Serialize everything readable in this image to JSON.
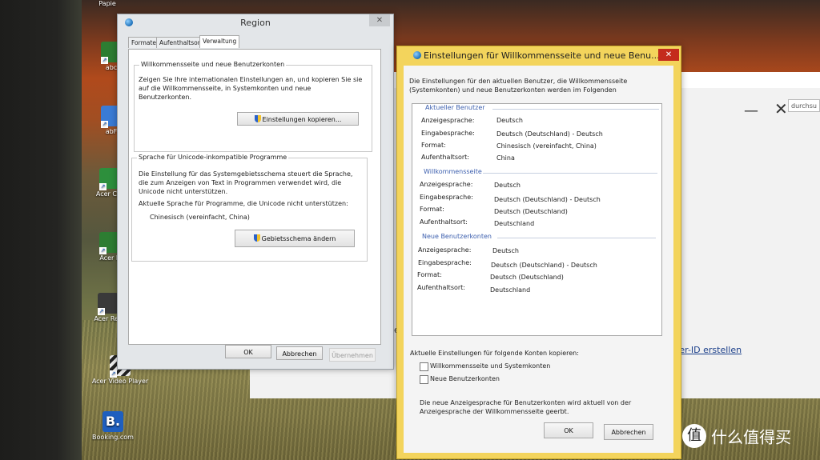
{
  "desktop": {
    "icons": [
      {
        "label": "Papie",
        "icon": "folder-icon",
        "color": "#d9b44a"
      },
      {
        "label": "abc",
        "icon": "app-icon",
        "color": "#2d7d32"
      },
      {
        "label": "abF",
        "icon": "app-icon",
        "color": "#3a7bd5"
      },
      {
        "label": "Acer Car",
        "icon": "app-icon",
        "color": "#2d8f3c"
      },
      {
        "label": "Acer P",
        "icon": "app-icon",
        "color": "#2d7d32"
      },
      {
        "label": "Acer Rev",
        "icon": "app-icon",
        "color": "#3a3a3a"
      },
      {
        "label": "Acer Video Player",
        "icon": "clapperboard-icon",
        "color": "#e0e0e0"
      },
      {
        "label": "Booking.com",
        "icon": "booking-icon",
        "color": "#1e5fbf"
      }
    ]
  },
  "back_window": {
    "search_placeholder": "durchsu",
    "minimize": "—",
    "close": "✕",
    "link": "Acer-ID erstellen",
    "fragment": "wie"
  },
  "region": {
    "title": "Region",
    "close": "✕",
    "tabs": [
      "Formate",
      "Aufenthaltsort",
      "Verwaltung"
    ],
    "active_tab": "Verwaltung",
    "group1": {
      "legend": "Willkommensseite und neue Benutzerkonten",
      "text": "Zeigen Sie Ihre internationalen Einstellungen an, und kopieren Sie sie auf die Willkommensseite, in Systemkonten und neue Benutzerkonten.",
      "button": "Einstellungen kopieren..."
    },
    "group2": {
      "legend": "Sprache für Unicode-inkompatible Programme",
      "text": "Die Einstellung für das Systemgebietsschema steuert die Sprache, die zum Anzeigen von Text in Programmen verwendet wird, die Unicode nicht unterstützen.",
      "current_label": "Aktuelle Sprache für Programme, die Unicode nicht unterstützen:",
      "current_value": "Chinesisch (vereinfacht, China)",
      "button": "Gebietsschema ändern"
    },
    "ok": "OK",
    "cancel": "Abbrechen",
    "apply": "Übernehmen"
  },
  "einst": {
    "title": "Einstellungen für Willkommensseite und neue Benu...",
    "close": "✕",
    "intro": "Die Einstellungen für den aktuellen Benutzer, die Willkommensseite (Systemkonten) und neue Benutzerkonten werden im Folgenden",
    "sections": [
      {
        "heading": "Aktueller Benutzer",
        "rows": [
          {
            "label": "Anzeigesprache:",
            "value": "Deutsch"
          },
          {
            "label": "Eingabesprache:",
            "value": "Deutsch (Deutschland) - Deutsch"
          },
          {
            "label": "Format:",
            "value": "Chinesisch (vereinfacht, China)"
          },
          {
            "label": "Aufenthaltsort:",
            "value": "China"
          }
        ]
      },
      {
        "heading": "Willkommensseite",
        "rows": [
          {
            "label": "Anzeigesprache:",
            "value": "Deutsch"
          },
          {
            "label": "Eingabesprache:",
            "value": "Deutsch (Deutschland) - Deutsch"
          },
          {
            "label": "Format:",
            "value": "Deutsch (Deutschland)"
          },
          {
            "label": "Aufenthaltsort:",
            "value": "Deutschland"
          }
        ]
      },
      {
        "heading": "Neue Benutzerkonten",
        "rows": [
          {
            "label": "Anzeigesprache:",
            "value": "Deutsch"
          },
          {
            "label": "Eingabesprache:",
            "value": "Deutsch (Deutschland) - Deutsch"
          },
          {
            "label": "Format:",
            "value": "Deutsch (Deutschland)"
          },
          {
            "label": "Aufenthaltsort:",
            "value": "Deutschland"
          }
        ]
      }
    ],
    "copy_label": "Aktuelle Einstellungen für folgende Konten kopieren:",
    "checkboxes": [
      {
        "label": "Willkommensseite und Systemkonten",
        "checked": false
      },
      {
        "label": "Neue Benutzerkonten",
        "checked": false
      }
    ],
    "note": "Die neue Anzeigesprache für Benutzerkonten wird aktuell von der Anzeigesprache der Willkommensseite geerbt.",
    "ok": "OK",
    "cancel": "Abbrechen"
  },
  "watermark": {
    "logo": "值",
    "text": "什么值得买"
  }
}
